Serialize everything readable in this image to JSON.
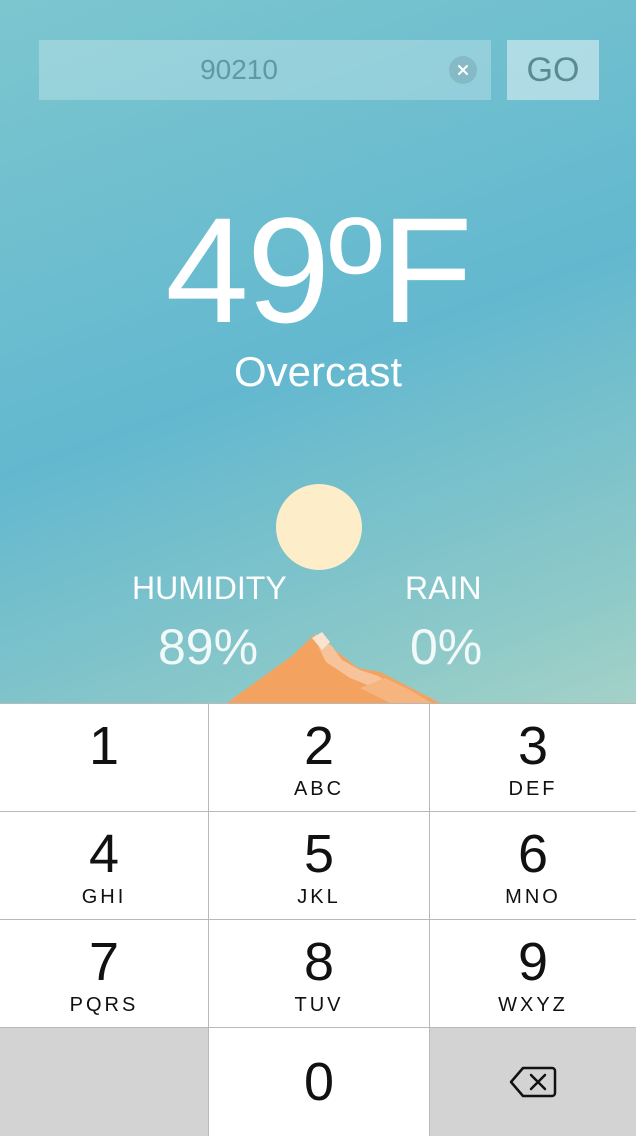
{
  "search": {
    "value": "90210",
    "clear_icon": "clear-circle-icon",
    "go_label": "GO"
  },
  "weather": {
    "temperature": "49ºF",
    "condition": "Overcast",
    "humidity_label": "HUMIDITY",
    "humidity_value": "89%",
    "rain_label": "RAIN",
    "rain_value": "0%"
  },
  "colors": {
    "sky_top": "#63b8cf",
    "sky_bottom": "#e8e6c6",
    "sun": "#fdedc8",
    "mountain": "#f4a25f"
  },
  "keypad": {
    "keys": [
      {
        "digit": "1",
        "letters": ""
      },
      {
        "digit": "2",
        "letters": "ABC"
      },
      {
        "digit": "3",
        "letters": "DEF"
      },
      {
        "digit": "4",
        "letters": "GHI"
      },
      {
        "digit": "5",
        "letters": "JKL"
      },
      {
        "digit": "6",
        "letters": "MNO"
      },
      {
        "digit": "7",
        "letters": "PQRS"
      },
      {
        "digit": "8",
        "letters": "TUV"
      },
      {
        "digit": "9",
        "letters": "WXYZ"
      },
      {
        "digit": "0",
        "letters": ""
      }
    ],
    "delete_icon": "backspace-icon"
  }
}
